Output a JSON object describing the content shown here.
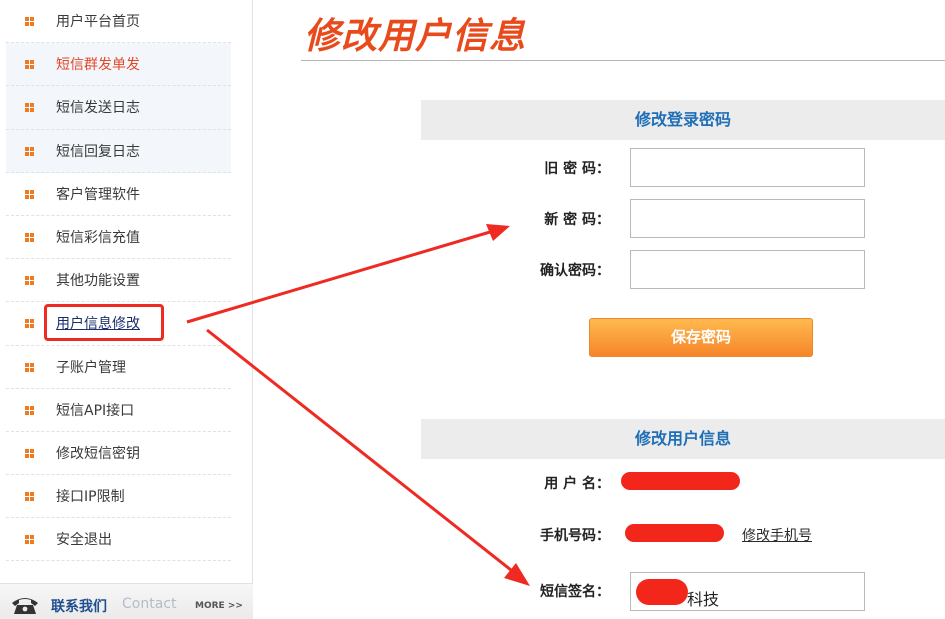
{
  "sidebar": {
    "items": [
      {
        "label": "用户平台首页"
      },
      {
        "label": "短信群发单发"
      },
      {
        "label": "短信发送日志"
      },
      {
        "label": "短信回复日志"
      },
      {
        "label": "客户管理软件"
      },
      {
        "label": "短信彩信充值"
      },
      {
        "label": "其他功能设置"
      },
      {
        "label": "用户信息修改"
      },
      {
        "label": "子账户管理"
      },
      {
        "label": "短信API接口"
      },
      {
        "label": "修改短信密钥"
      },
      {
        "label": "接口IP限制"
      },
      {
        "label": "安全退出"
      }
    ],
    "active_index": 1,
    "current_index": 7,
    "contact": {
      "cn": "联系我们",
      "en": "Contact",
      "more": "MORE >>"
    }
  },
  "page": {
    "title": "修改用户信息"
  },
  "password_section": {
    "title": "修改登录密码",
    "old_label": "旧 密 码：",
    "new_label": "新 密 码：",
    "confirm_label": "确认密码：",
    "save_button": "保存密码"
  },
  "user_section": {
    "title": "修改用户信息",
    "username_label": "用 户 名：",
    "phone_label": "手机号码：",
    "change_phone_link": "修改手机号",
    "signature_label": "短信签名：",
    "signature_value": "科技"
  },
  "colors": {
    "accent": "#e94a1b",
    "heading_blue": "#1f6fb8",
    "annotation_red": "#ee2a22",
    "button_orange": "#f6852a"
  },
  "icons": {
    "menu_bullet": "grid-bullet-icon",
    "contact": "telephone-icon"
  }
}
